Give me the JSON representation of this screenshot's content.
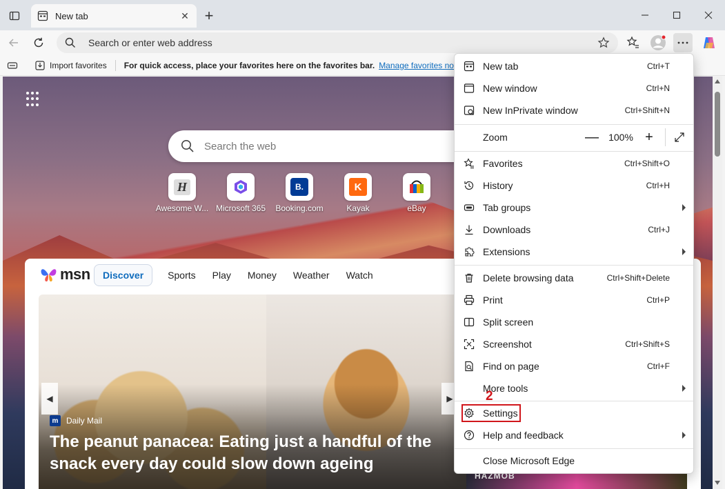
{
  "window": {
    "tab_title": "New tab",
    "new_tab_symbol": "+",
    "close_symbol": "✕"
  },
  "address_bar": {
    "placeholder": "Search or enter web address"
  },
  "favorites_bar": {
    "import_label": "Import favorites",
    "message": "For quick access, place your favorites here on the favorites bar.",
    "manage_link": "Manage favorites now"
  },
  "newtab": {
    "search_placeholder": "Search the web",
    "quick_links": [
      {
        "label": "Awesome W...",
        "icon": "awesome-screenshot-icon",
        "glyph": "H"
      },
      {
        "label": "Microsoft 365",
        "icon": "microsoft-365-icon",
        "glyph": ""
      },
      {
        "label": "Booking.com",
        "icon": "booking-icon",
        "glyph": "B."
      },
      {
        "label": "Kayak",
        "icon": "kayak-icon",
        "glyph": "K"
      },
      {
        "label": "eBay",
        "icon": "ebay-icon",
        "glyph": ""
      }
    ],
    "feed": {
      "brand": "msn",
      "tabs": [
        "Discover",
        "Sports",
        "Play",
        "Money",
        "Weather",
        "Watch"
      ],
      "active_tab": "Discover",
      "hero": {
        "source": "Daily Mail",
        "source_glyph": "m",
        "headline": "The peanut panacea: Eating just a handful of the snack every day could slow down ageing"
      },
      "side_card_text": "HAZMOB"
    }
  },
  "menu": {
    "items": [
      {
        "label": "New tab",
        "shortcut": "Ctrl+T",
        "icon": "new-tab-icon"
      },
      {
        "label": "New window",
        "shortcut": "Ctrl+N",
        "icon": "new-window-icon"
      },
      {
        "label": "New InPrivate window",
        "shortcut": "Ctrl+Shift+N",
        "icon": "inprivate-icon"
      },
      {
        "label": "Favorites",
        "shortcut": "Ctrl+Shift+O",
        "icon": "favorites-icon"
      },
      {
        "label": "History",
        "shortcut": "Ctrl+H",
        "icon": "history-icon"
      },
      {
        "label": "Tab groups",
        "shortcut": "",
        "icon": "tab-groups-icon",
        "submenu": true
      },
      {
        "label": "Downloads",
        "shortcut": "Ctrl+J",
        "icon": "downloads-icon"
      },
      {
        "label": "Extensions",
        "shortcut": "",
        "icon": "extensions-icon",
        "submenu": true
      },
      {
        "label": "Delete browsing data",
        "shortcut": "Ctrl+Shift+Delete",
        "icon": "trash-icon"
      },
      {
        "label": "Print",
        "shortcut": "Ctrl+P",
        "icon": "print-icon"
      },
      {
        "label": "Split screen",
        "shortcut": "",
        "icon": "split-screen-icon"
      },
      {
        "label": "Screenshot",
        "shortcut": "Ctrl+Shift+S",
        "icon": "screenshot-icon"
      },
      {
        "label": "Find on page",
        "shortcut": "Ctrl+F",
        "icon": "find-icon"
      },
      {
        "label": "More tools",
        "shortcut": "",
        "icon": "",
        "submenu": true
      },
      {
        "label": "Settings",
        "shortcut": "",
        "icon": "gear-icon"
      },
      {
        "label": "Help and feedback",
        "shortcut": "",
        "icon": "help-icon",
        "submenu": true
      },
      {
        "label": "Close Microsoft Edge",
        "shortcut": "",
        "icon": ""
      }
    ],
    "zoom": {
      "label": "Zoom",
      "value": "100%",
      "minus": "—",
      "plus": "+"
    },
    "annotation_number": "2"
  },
  "colors": {
    "accent": "#0f6cbd",
    "annotation": "#d0161b",
    "titlebar": "#dfe3e8"
  }
}
